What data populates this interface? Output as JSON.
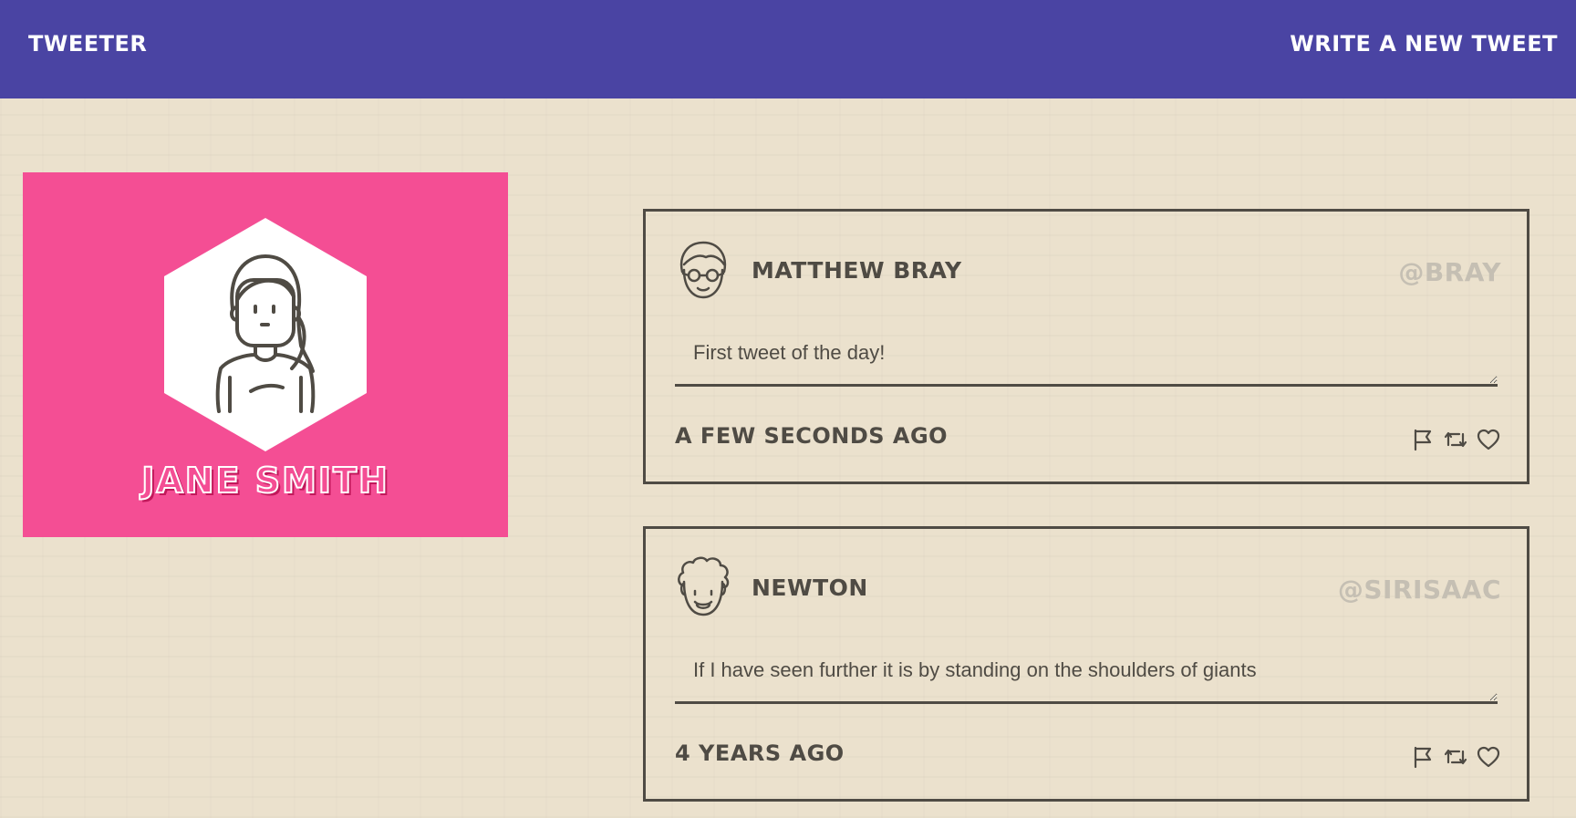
{
  "navbar": {
    "brand": "TWEETER",
    "write_label": "WRITE A NEW TWEET",
    "background": "#4a44a3"
  },
  "profile": {
    "name": "JANE SMITH",
    "card_color": "#f44e94",
    "avatar_icon": "woman-avatar-icon"
  },
  "tweets": [
    {
      "author": "MATTHEW BRAY",
      "handle": "@BRAY",
      "text": "First tweet of the day!",
      "time": "A FEW SECONDS AGO",
      "avatar_icon": "man-with-glasses-avatar-icon",
      "actions": [
        "flag-icon",
        "retweet-icon",
        "heart-icon"
      ]
    },
    {
      "author": "NEWTON",
      "handle": "@SIRISAAC",
      "text": "If I have seen further it is by standing on the shoulders of giants",
      "time": "4 YEARS AGO",
      "avatar_icon": "curly-hair-man-avatar-icon",
      "actions": [
        "flag-icon",
        "retweet-icon",
        "heart-icon"
      ]
    }
  ],
  "colors": {
    "page_background": "#ebe1cd",
    "text_dark": "#4f4b44",
    "handle_muted": "#c5bfb3"
  }
}
